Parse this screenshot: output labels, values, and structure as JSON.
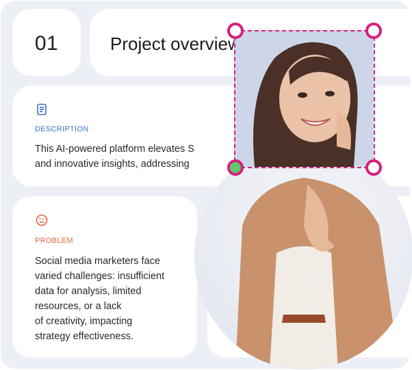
{
  "step": {
    "number": "01"
  },
  "header": {
    "title": "Project overview"
  },
  "description": {
    "label": "DESCRIPTION",
    "icon": "document-icon",
    "text": "This AI-powered platform elevates S\nand innovative insights,  addressing"
  },
  "problem": {
    "label": "PROBLEM",
    "icon": "sad-face-icon",
    "text": "Social media marketers face\nvaried challenges: insufficient\ndata for analysis, limited\nresources, or a lack\nof creativity, impacting\nstrategy effectiveness."
  },
  "colors": {
    "description_accent": "#3a6fd0",
    "problem_accent": "#e2673a",
    "crop_accent": "#d6207e",
    "active_handle": "#5ccb6a"
  }
}
